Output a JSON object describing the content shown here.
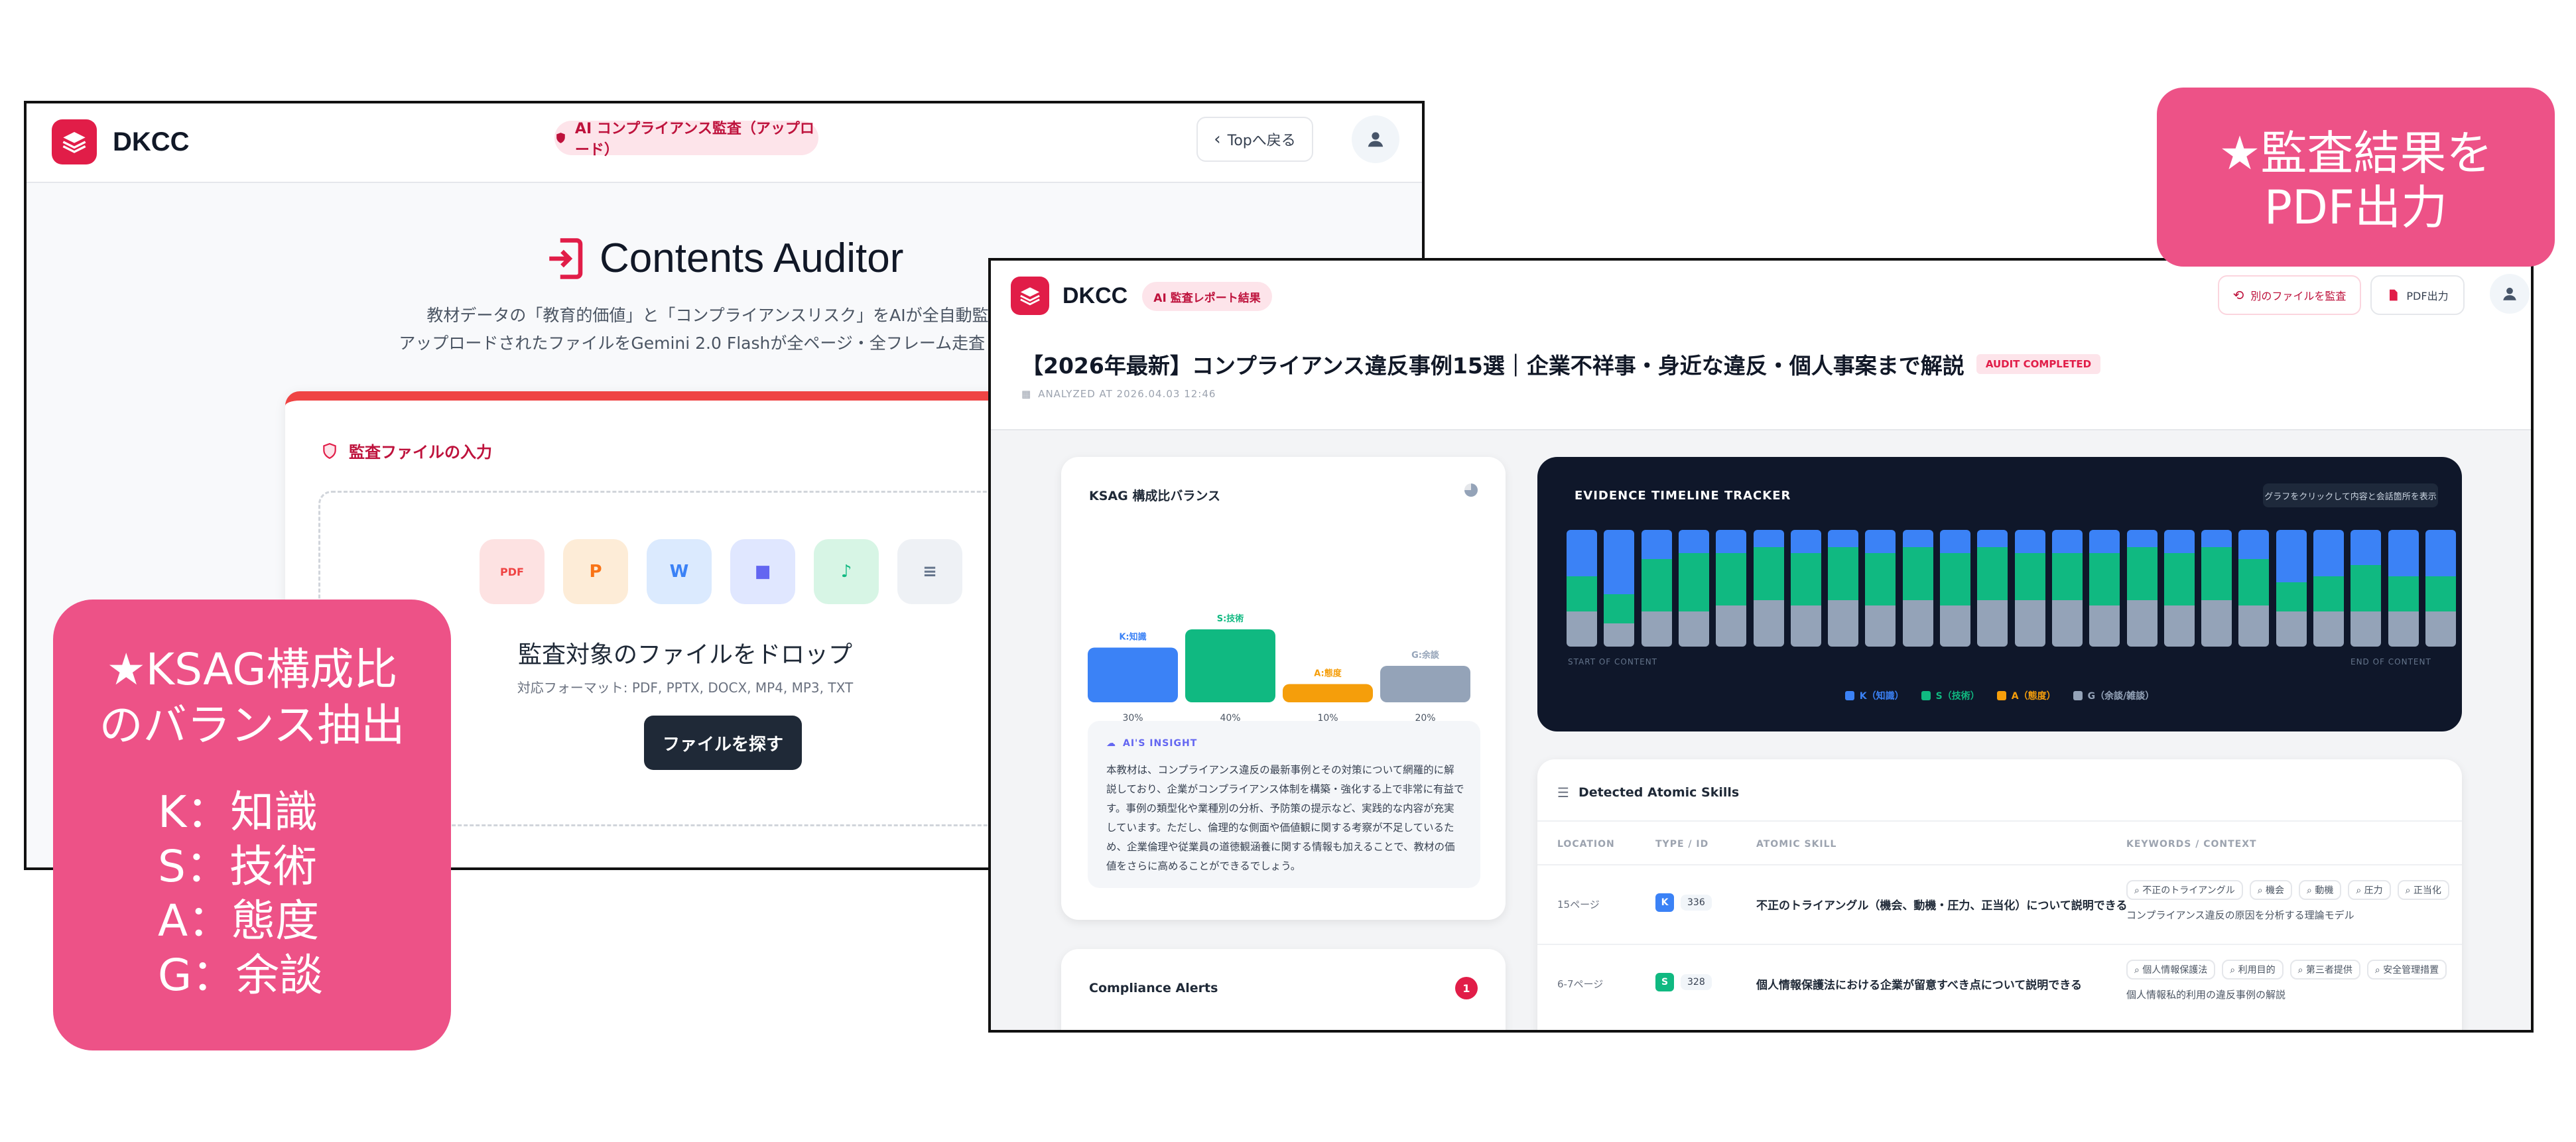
{
  "upload_window": {
    "brand": "DKCC",
    "mode_pill": "AI コンプライアンス監査（アップロード）",
    "back_button": "Topへ戻る",
    "title": "Contents Auditor",
    "subtitle_line1": "教材データの「教育的価値」と「コンプライアンスリスク」をAIが全自動監査。",
    "subtitle_line2": "アップロードされたファイルをGemini 2.0 Flashが全ページ・全フレーム走査します。",
    "input_section_label": "監査ファイルの入力",
    "file_types": [
      {
        "name": "pdf-file-icon",
        "label": "PDF",
        "bg": "#fde2e2",
        "fg": "#ef4444"
      },
      {
        "name": "pptx-file-icon",
        "label": "P",
        "bg": "#fdecd7",
        "fg": "#f97316"
      },
      {
        "name": "docx-file-icon",
        "label": "W",
        "bg": "#dbeafe",
        "fg": "#3b82f6"
      },
      {
        "name": "mp4-video-icon",
        "label": "",
        "bg": "#e0e7ff",
        "fg": "#6366f1"
      },
      {
        "name": "mp3-audio-icon",
        "label": "",
        "bg": "#d7f5e5",
        "fg": "#10b981"
      },
      {
        "name": "txt-file-icon",
        "label": "",
        "bg": "#eef1f5",
        "fg": "#64748b"
      }
    ],
    "drop_heading": "監査対象のファイルをドロップ",
    "formats": "対応フォーマット: PDF, PPTX, DOCX, MP4, MP3, TXT",
    "browse_button": "ファイルを探す"
  },
  "report_window": {
    "brand": "DKCC",
    "mode_pill": "AI 監査レポート結果",
    "reaudit_button": "別のファイルを監査",
    "pdf_button": "PDF出力",
    "report_title": "【2026年最新】コンプライアンス違反事例15選｜企業不祥事・身近な違反・個人事案まで解説",
    "status_badge": "AUDIT COMPLETED",
    "analyzed_at": "ANALYZED AT  2026.04.03 12:46",
    "ksag": {
      "title": "KSAG 構成比バランス",
      "bars": [
        {
          "label": "K:知識",
          "value": 30,
          "pct": "30%",
          "color": "#3b82f6"
        },
        {
          "label": "S:技術",
          "value": 40,
          "pct": "40%",
          "color": "#10b981"
        },
        {
          "label": "A:態度",
          "value": 10,
          "pct": "10%",
          "color": "#f59e0b"
        },
        {
          "label": "G:余談",
          "value": 20,
          "pct": "20%",
          "color": "#94a3b8"
        }
      ],
      "insight_label": "AI'S INSIGHT",
      "insight_text": "本教材は、コンプライアンス違反の最新事例とその対策について網羅的に解説しており、企業がコンプライアンス体制を構築・強化する上で非常に有益です。事例の類型化や業種別の分析、予防策の提示など、実践的な内容が充実しています。ただし、倫理的な側面や価値観に関する考察が不足しているため、企業倫理や従業員の道徳観涵養に関する情報も加えることで、教材の価値をさらに高めることができるでしょう。"
    },
    "alerts": {
      "title": "Compliance Alerts",
      "count": "1"
    },
    "tracker": {
      "title": "EVIDENCE TIMELINE TRACKER",
      "hint": "グラフをクリックして内容と会話箇所を表示",
      "start_label": "START OF CONTENT",
      "end_label": "END OF CONTENT",
      "legend": [
        {
          "label": "K（知識）",
          "color": "#3b82f6"
        },
        {
          "label": "S（技術）",
          "color": "#10b981"
        },
        {
          "label": "A（態度）",
          "color": "#f59e0b"
        },
        {
          "label": "G（余談/雑談）",
          "color": "#94a3b8"
        }
      ],
      "segments": [
        [
          40,
          30,
          0,
          30
        ],
        [
          55,
          25,
          0,
          20
        ],
        [
          25,
          45,
          0,
          30
        ],
        [
          20,
          50,
          0,
          30
        ],
        [
          20,
          45,
          0,
          35
        ],
        [
          15,
          45,
          0,
          40
        ],
        [
          20,
          45,
          0,
          35
        ],
        [
          15,
          45,
          0,
          40
        ],
        [
          20,
          45,
          0,
          35
        ],
        [
          15,
          45,
          0,
          40
        ],
        [
          20,
          45,
          0,
          35
        ],
        [
          15,
          45,
          0,
          40
        ],
        [
          20,
          40,
          0,
          40
        ],
        [
          20,
          40,
          0,
          40
        ],
        [
          20,
          45,
          0,
          35
        ],
        [
          15,
          45,
          0,
          40
        ],
        [
          20,
          45,
          0,
          35
        ],
        [
          15,
          45,
          0,
          40
        ],
        [
          25,
          40,
          0,
          35
        ],
        [
          45,
          25,
          0,
          30
        ],
        [
          40,
          30,
          0,
          30
        ],
        [
          30,
          40,
          0,
          30
        ],
        [
          40,
          30,
          0,
          30
        ],
        [
          40,
          30,
          0,
          30
        ]
      ]
    },
    "skills": {
      "title": "Detected Atomic Skills",
      "columns": [
        "LOCATION",
        "TYPE / ID",
        "ATOMIC SKILL",
        "KEYWORDS / CONTEXT"
      ],
      "rows": [
        {
          "location": "15ページ",
          "type": "K",
          "type_color": "#3b82f6",
          "id": "336",
          "skill": "不正のトライアングル（機会、動機・圧力、正当化）について説明できる",
          "keywords": [
            "不正のトライアングル",
            "機会",
            "動機",
            "圧力",
            "正当化"
          ],
          "context": "コンプライアンス違反の原因を分析する理論モデル"
        },
        {
          "location": "6-7ページ",
          "type": "S",
          "type_color": "#10b981",
          "id": "328",
          "skill": "個人情報保護法における企業が留意すべき点について説明できる",
          "keywords": [
            "個人情報保護法",
            "利用目的",
            "第三者提供",
            "安全管理措置"
          ],
          "context": "個人情報私的利用の違反事例の解説"
        }
      ]
    }
  },
  "callouts": {
    "ksag_title_line1": "★KSAG構成比",
    "ksag_title_line2": "のバランス抽出",
    "ksag_items": [
      "K：知識",
      "S：技術",
      "A：態度",
      "G：余談"
    ],
    "pdf_line1": "★監査結果を",
    "pdf_line2": "PDF出力"
  }
}
